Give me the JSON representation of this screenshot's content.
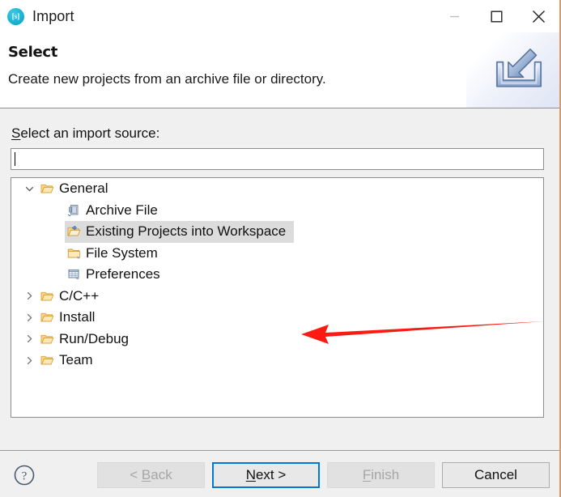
{
  "window": {
    "title": "Import",
    "icon": "eclipse-import-icon",
    "controls": [
      {
        "name": "minimize-button",
        "glyph": "minimize-icon",
        "enabled": false
      },
      {
        "name": "maximize-button",
        "glyph": "maximize-icon",
        "enabled": true
      },
      {
        "name": "close-button",
        "glyph": "close-icon",
        "enabled": true
      }
    ]
  },
  "header": {
    "title": "Select",
    "description": "Create new projects from an archive file or directory.",
    "banner_icon": "import-tray-arrow-icon"
  },
  "form": {
    "source_label_mnemonic": "S",
    "source_label_rest": "elect an import source:",
    "source_value": "",
    "source_placeholder": ""
  },
  "tree": {
    "items": [
      {
        "label": "General",
        "depth": 1,
        "twisty": "chevron-down-icon",
        "icon": "open-folder-icon",
        "selected": false,
        "expanded": true
      },
      {
        "label": "Archive File",
        "depth": 2,
        "twisty": "",
        "icon": "archive-file-icon",
        "selected": false,
        "expanded": false
      },
      {
        "label": "Existing Projects into Workspace",
        "depth": 2,
        "twisty": "",
        "icon": "existing-projects-icon",
        "selected": true,
        "expanded": false
      },
      {
        "label": "File System",
        "depth": 2,
        "twisty": "",
        "icon": "file-system-folder-icon",
        "selected": false,
        "expanded": false
      },
      {
        "label": "Preferences",
        "depth": 2,
        "twisty": "",
        "icon": "preferences-icon",
        "selected": false,
        "expanded": false
      },
      {
        "label": "C/C++",
        "depth": 1,
        "twisty": "chevron-right-icon",
        "icon": "open-folder-icon",
        "selected": false,
        "expanded": false
      },
      {
        "label": "Install",
        "depth": 1,
        "twisty": "chevron-right-icon",
        "icon": "open-folder-icon",
        "selected": false,
        "expanded": false
      },
      {
        "label": "Run/Debug",
        "depth": 1,
        "twisty": "chevron-right-icon",
        "icon": "open-folder-icon",
        "selected": false,
        "expanded": false
      },
      {
        "label": "Team",
        "depth": 1,
        "twisty": "chevron-right-icon",
        "icon": "open-folder-icon",
        "selected": false,
        "expanded": false
      }
    ]
  },
  "annotation": {
    "type": "arrow",
    "direction": "left",
    "color": "#FC1A12",
    "points_at": "Existing Projects into Workspace"
  },
  "footer": {
    "help_icon": "help-question-icon",
    "buttons": [
      {
        "name": "back-button",
        "label": "< Back",
        "mnemonic": "B",
        "state": "disabled"
      },
      {
        "name": "next-button",
        "label": "Next >",
        "mnemonic": "N",
        "state": "default"
      },
      {
        "name": "finish-button",
        "label": "Finish",
        "mnemonic": "F",
        "state": "disabled"
      },
      {
        "name": "cancel-button",
        "label": "Cancel",
        "mnemonic": "",
        "state": "normal"
      }
    ]
  },
  "colors": {
    "accent": "#0078d7",
    "annotation_red": "#FC1A12",
    "dialog_bg": "#f0f0f0",
    "selection_bg": "#dcdcdc",
    "window_border": "#d99a6c"
  }
}
